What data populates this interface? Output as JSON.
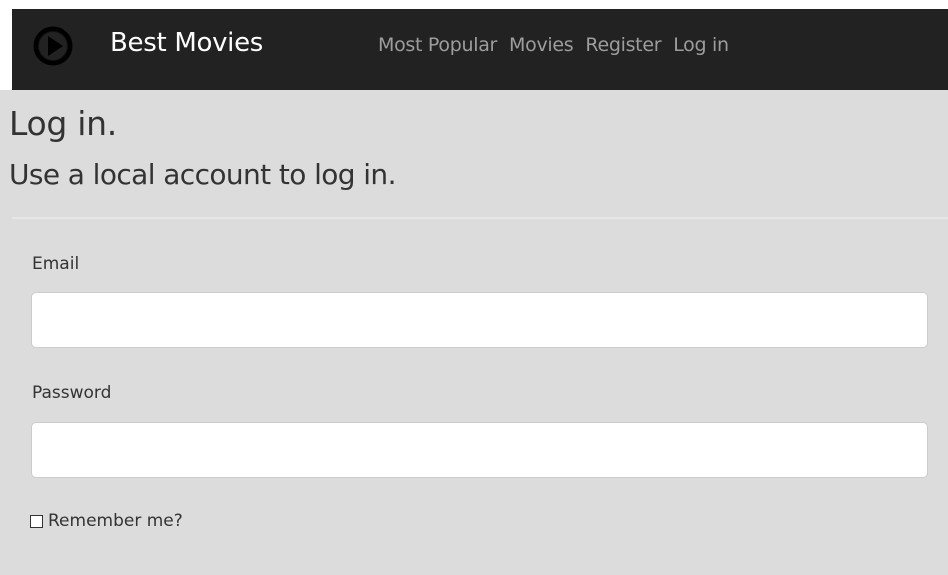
{
  "navbar": {
    "brand": "Best Movies",
    "brand_icon": "play-circle-icon",
    "links": [
      {
        "label": "Most Popular"
      },
      {
        "label": "Movies"
      },
      {
        "label": "Register"
      },
      {
        "label": "Log in"
      }
    ],
    "background": "#222222",
    "link_color": "#9d9d9d"
  },
  "main": {
    "title": "Log in.",
    "subtitle": "Use a local account to log in.",
    "form": {
      "email_label": "Email",
      "email_value": "",
      "password_label": "Password",
      "password_value": "",
      "remember_label": "Remember me?",
      "remember_checked": false
    },
    "background": "#dcdcdc"
  }
}
